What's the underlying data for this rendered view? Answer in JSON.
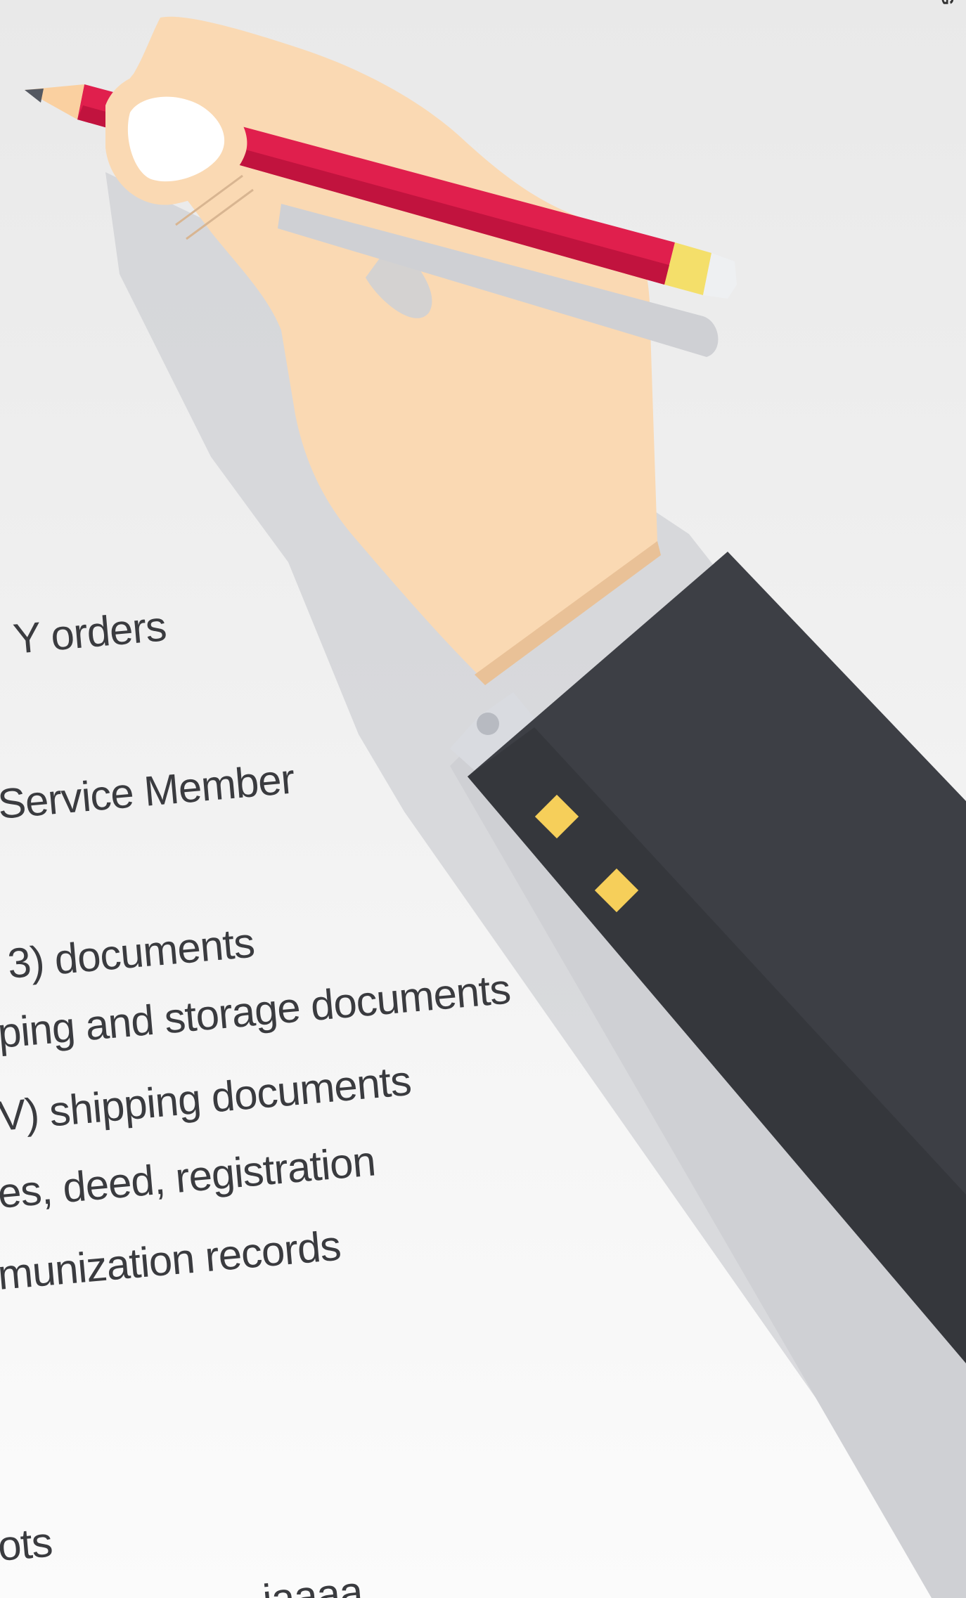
{
  "checklist": {
    "items": [
      "Y orders",
      "Service Member",
      "3) documents",
      "ping and storage documents",
      "V) shipping documents",
      "es, deed, registration",
      "munization records",
      "ots",
      "...iaaaa"
    ]
  },
  "corner_mark": "G",
  "colors": {
    "paper": "#efefef",
    "skin": "#fad9b3",
    "skin_shadow": "#e9c197",
    "pencil": "#e01f4d",
    "pencil_dark": "#c1133e",
    "eraser_band": "#f4df6a",
    "sleeve": "#3d3f45",
    "sleeve_shadow": "#cfd0d4",
    "cufflink": "#f6cf5a",
    "hand_shadow": "#cdd0d6"
  }
}
